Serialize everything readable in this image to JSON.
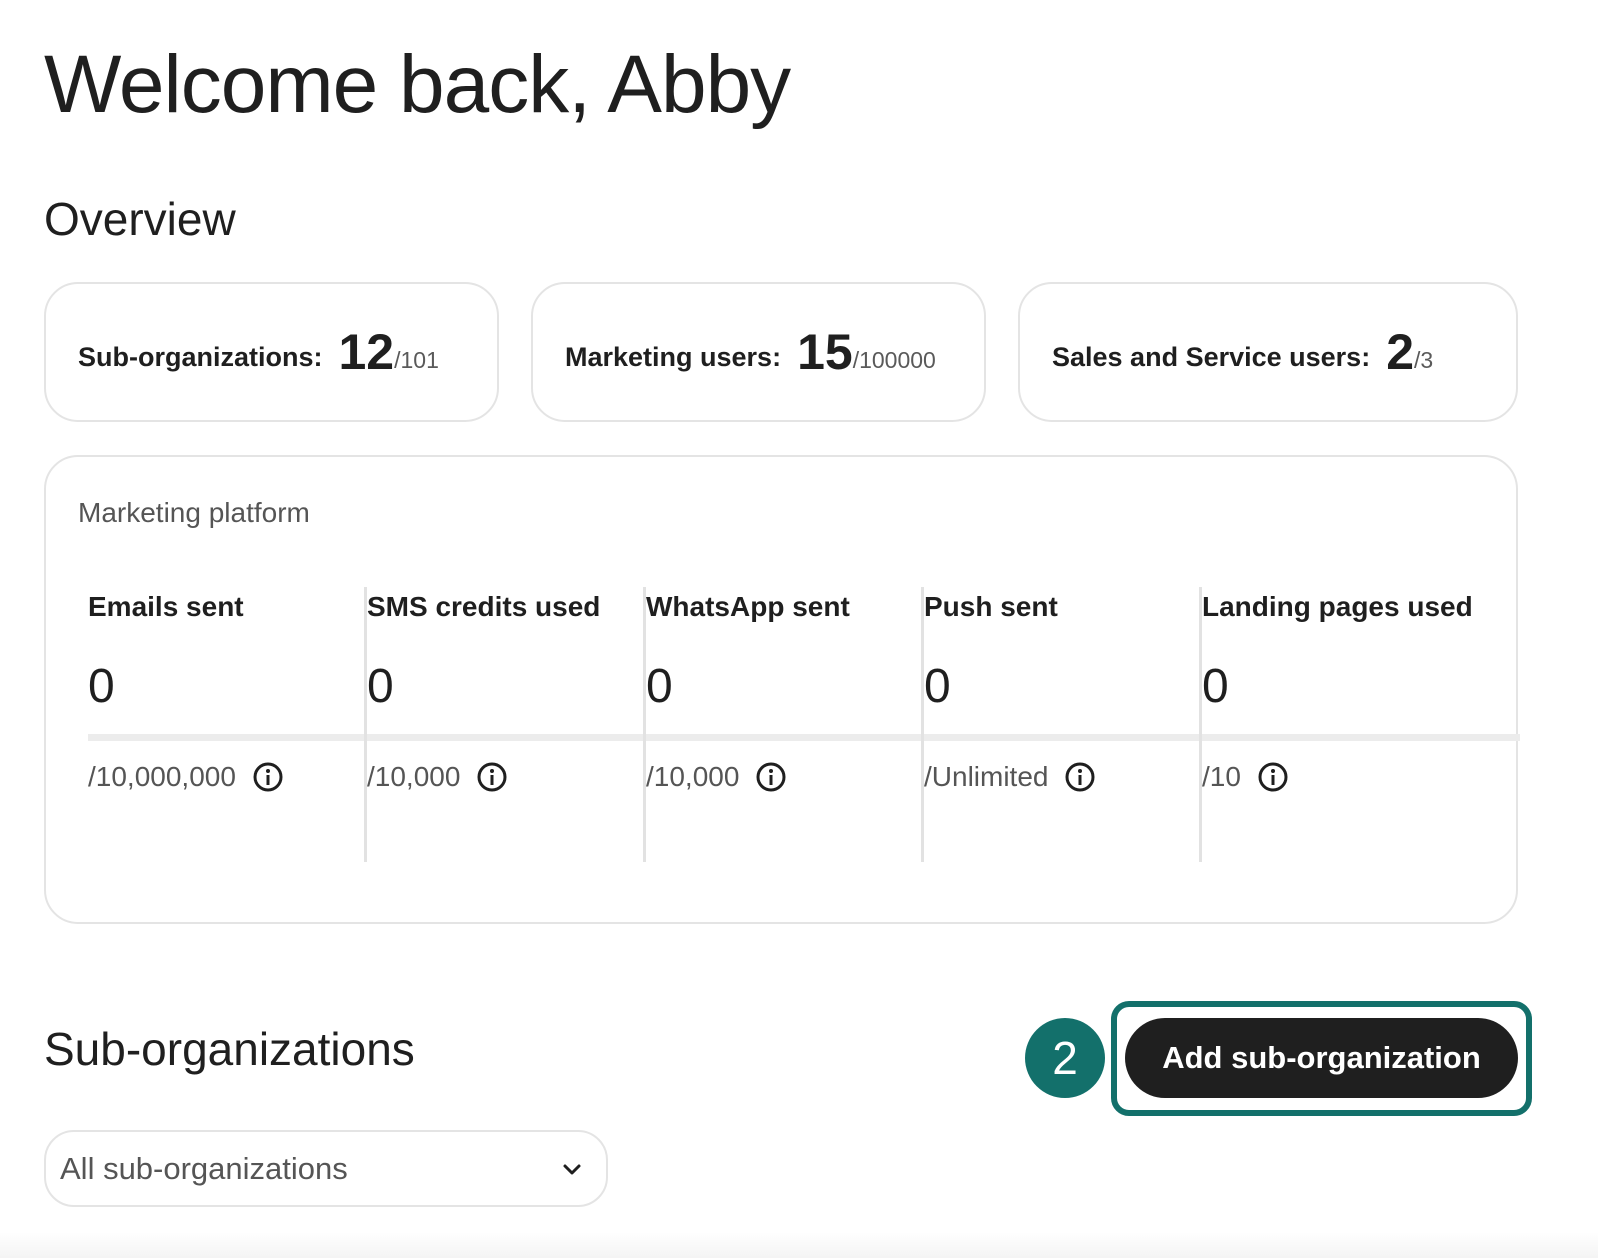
{
  "header": {
    "greeting": "Welcome back, Abby"
  },
  "overview": {
    "title": "Overview",
    "stats": [
      {
        "label": "Sub-organizations:",
        "value": "12",
        "limit": "/101"
      },
      {
        "label": "Marketing users:",
        "value": "15",
        "limit": "/100000"
      },
      {
        "label": "Sales and Service users:",
        "value": "2",
        "limit": "/3"
      }
    ]
  },
  "platform": {
    "title": "Marketing platform",
    "metrics": [
      {
        "label": "Emails sent",
        "value": "0",
        "limit": "/10,000,000",
        "icon": "info-icon"
      },
      {
        "label": "SMS credits used",
        "value": "0",
        "limit": "/10,000",
        "icon": "info-icon"
      },
      {
        "label": "WhatsApp sent",
        "value": "0",
        "limit": "/10,000",
        "icon": "info-icon"
      },
      {
        "label": "Push sent",
        "value": "0",
        "limit": "/Unlimited",
        "icon": "info-icon"
      },
      {
        "label": "Landing pages used",
        "value": "0",
        "limit": "/10",
        "icon": "info-icon"
      }
    ]
  },
  "suborganizations": {
    "title": "Sub-organizations",
    "step_badge": "2",
    "add_button_label": "Add sub-organization",
    "filter": {
      "selected": "All sub-organizations",
      "icon": "chevron-down-icon"
    }
  },
  "colors": {
    "accent": "#13706b",
    "button_bg": "#1f1f1f",
    "text": "#1f1f1f",
    "muted": "#555555",
    "border": "#e4e4e4"
  }
}
